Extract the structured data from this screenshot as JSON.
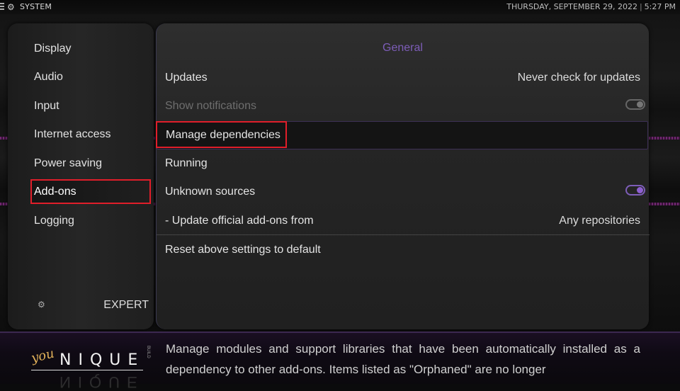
{
  "header": {
    "menu_icon": "hamburger-icon",
    "section_icon": "gears-icon",
    "title": "SYSTEM",
    "date": "THURSDAY, SEPTEMBER 29, 2022",
    "separator": "|",
    "time": "5:27 PM"
  },
  "categories": {
    "items": [
      {
        "label": "Display"
      },
      {
        "label": "Audio"
      },
      {
        "label": "Input"
      },
      {
        "label": "Internet access"
      },
      {
        "label": "Power saving"
      },
      {
        "label": "Add-ons",
        "selected": true
      },
      {
        "label": "Logging"
      }
    ],
    "level_icon": "settings-level-icon",
    "level_label": "EXPERT"
  },
  "settings": {
    "section_title": "General",
    "rows": [
      {
        "label": "Updates",
        "value": "Never check for updates"
      },
      {
        "label": "Show notifications",
        "type": "toggle",
        "enabled": false,
        "state": "off"
      },
      {
        "label": "Manage dependencies",
        "focused": true
      },
      {
        "label": "Running"
      },
      {
        "label": "Unknown sources",
        "type": "toggle",
        "state": "on"
      },
      {
        "label": "- Update official add-ons from",
        "value": "Any repositories"
      },
      {
        "label": "Reset above settings to default"
      }
    ]
  },
  "footer": {
    "logo_you": "you",
    "logo_nique": "NIQUE",
    "logo_build": "BUILD",
    "description": "Manage modules and support libraries that have been automatically installed as a dependency to other add-ons. Items listed as \"Orphaned\" are no longer"
  },
  "colors": {
    "accent": "#7d5db8",
    "focus_outline": "#e01e2a",
    "toggle_on": "#8e5fd0"
  }
}
